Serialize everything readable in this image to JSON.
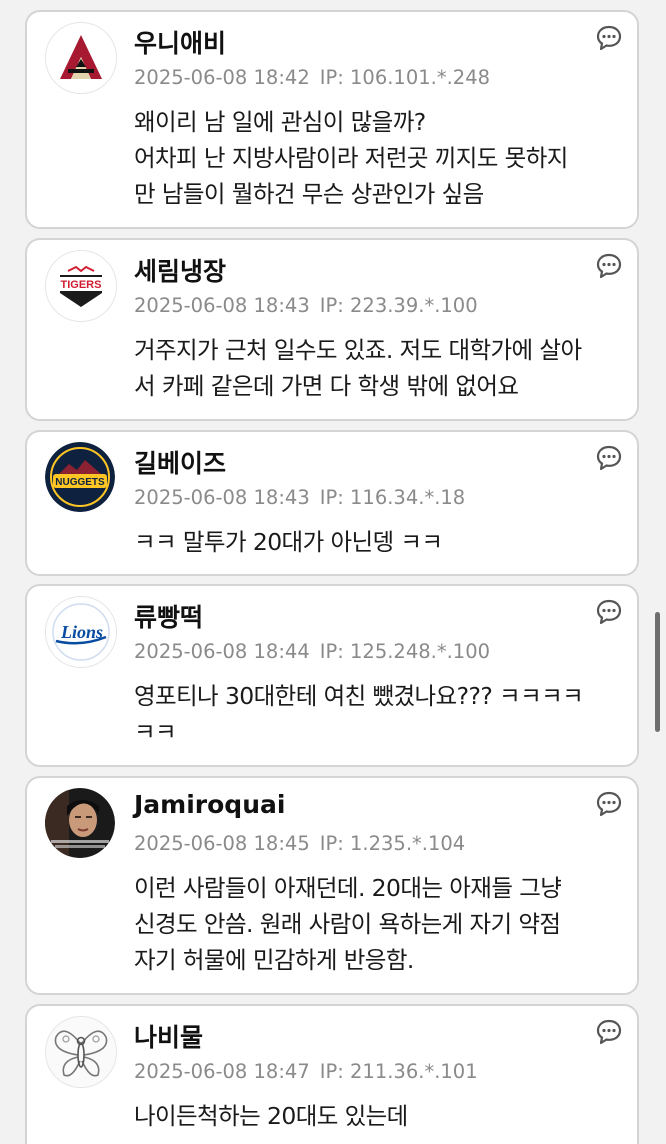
{
  "comments": [
    {
      "nickname": "우니애비",
      "date": "2025-06-08 18:42",
      "ip": "IP: 106.101.*.248",
      "avatar_icon": "diamondbacks-a-logo-icon",
      "lines": [
        "왜이리 남 일에 관심이 많을까?",
        "어차피 난 지방사람이라 저런곳 끼지도 못하지",
        "만 남들이 뭘하건 무슨 상관인가 싶음"
      ]
    },
    {
      "nickname": "세림냉장",
      "date": "2025-06-08 18:43",
      "ip": "IP: 223.39.*.100",
      "avatar_icon": "tigers-logo-icon",
      "avatar_text": "TIGERS",
      "lines": [
        "거주지가 근처 일수도 있죠. 저도 대학가에 살아",
        "서 카페 같은데 가면 다 학생 밖에 없어요"
      ]
    },
    {
      "nickname": "길베이즈",
      "date": "2025-06-08 18:43",
      "ip": "IP: 116.34.*.18",
      "avatar_icon": "nuggets-logo-icon",
      "avatar_text": "NUGGETS",
      "lines": [
        "ㅋㅋ 말투가 20대가 아닌뎅 ㅋㅋ"
      ]
    },
    {
      "nickname": "류빵떡",
      "date": "2025-06-08 18:44",
      "ip": "IP: 125.248.*.100",
      "avatar_icon": "lions-logo-icon",
      "avatar_text": "Lions",
      "lines": [
        "영포티나 30대한테 여친 뺐겼나요??? ㅋㅋㅋㅋ",
        "ㅋㅋ"
      ]
    },
    {
      "nickname": "Jamiroquai",
      "date": "2025-06-08 18:45",
      "ip": "IP: 1.235.*.104",
      "avatar_icon": "person-photo-icon",
      "lines": [
        "이런 사람들이 아재던데. 20대는 아재들 그냥",
        "신경도 안씀. 원래 사람이 욕하는게 자기 약점",
        "자기 허물에 민감하게 반응함."
      ]
    },
    {
      "nickname": "나비물",
      "date": "2025-06-08 18:47",
      "ip": "IP: 211.36.*.101",
      "avatar_icon": "butterfly-sketch-icon",
      "lines": [
        "나이든척하는 20대도 있는데"
      ]
    }
  ],
  "colors": {
    "background": "#f2f2f2",
    "card": "#ffffff",
    "border": "#d4d4d4",
    "meta_text": "#8a8a8a",
    "body_text": "#1a1a1a"
  }
}
